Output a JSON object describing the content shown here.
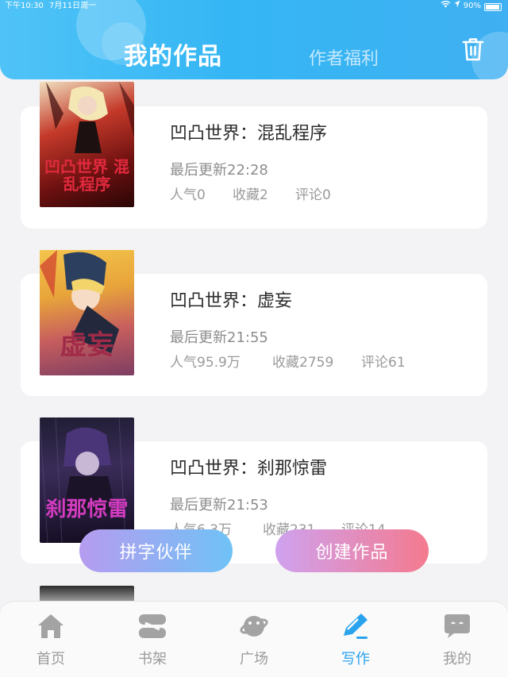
{
  "status_bar": {
    "time": "下午10:30",
    "date": "7月11日周一",
    "battery": "90%"
  },
  "header": {
    "tab_my_works": "我的作品",
    "tab_author_benefits": "作者福利",
    "trash_icon": "trash-icon"
  },
  "books": [
    {
      "title": "凹凸世界：混乱程序",
      "updated": "最后更新22:28",
      "popularity": "人气0",
      "favorites": "收藏2",
      "comments": "评论0",
      "cover_text": "凹凸世界 混乱程序"
    },
    {
      "title": "凹凸世界：虚妄",
      "updated": "最后更新21:55",
      "popularity": "人气95.9万",
      "favorites": "收藏2759",
      "comments": "评论61",
      "cover_text": "虚妄"
    },
    {
      "title": "凹凸世界：刹那惊雷",
      "updated": "最后更新21:53",
      "popularity": "人气6.3万",
      "favorites": "收藏231",
      "comments": "评论14",
      "cover_text": "刹那惊雷"
    }
  ],
  "buttons": {
    "partner": "拼字伙伴",
    "create": "创建作品"
  },
  "bottom_nav": [
    {
      "label": "首页",
      "icon": "home-icon"
    },
    {
      "label": "书架",
      "icon": "bookshelf-icon"
    },
    {
      "label": "广场",
      "icon": "planet-icon"
    },
    {
      "label": "写作",
      "icon": "pen-icon",
      "active": true
    },
    {
      "label": "我的",
      "icon": "chat-bubble-icon"
    }
  ],
  "colors": {
    "header_blue": "#35b6f4",
    "active_nav": "#2aa3ee",
    "create_pink": "#f47a8f",
    "partner_blue": "#6fc2f6"
  }
}
